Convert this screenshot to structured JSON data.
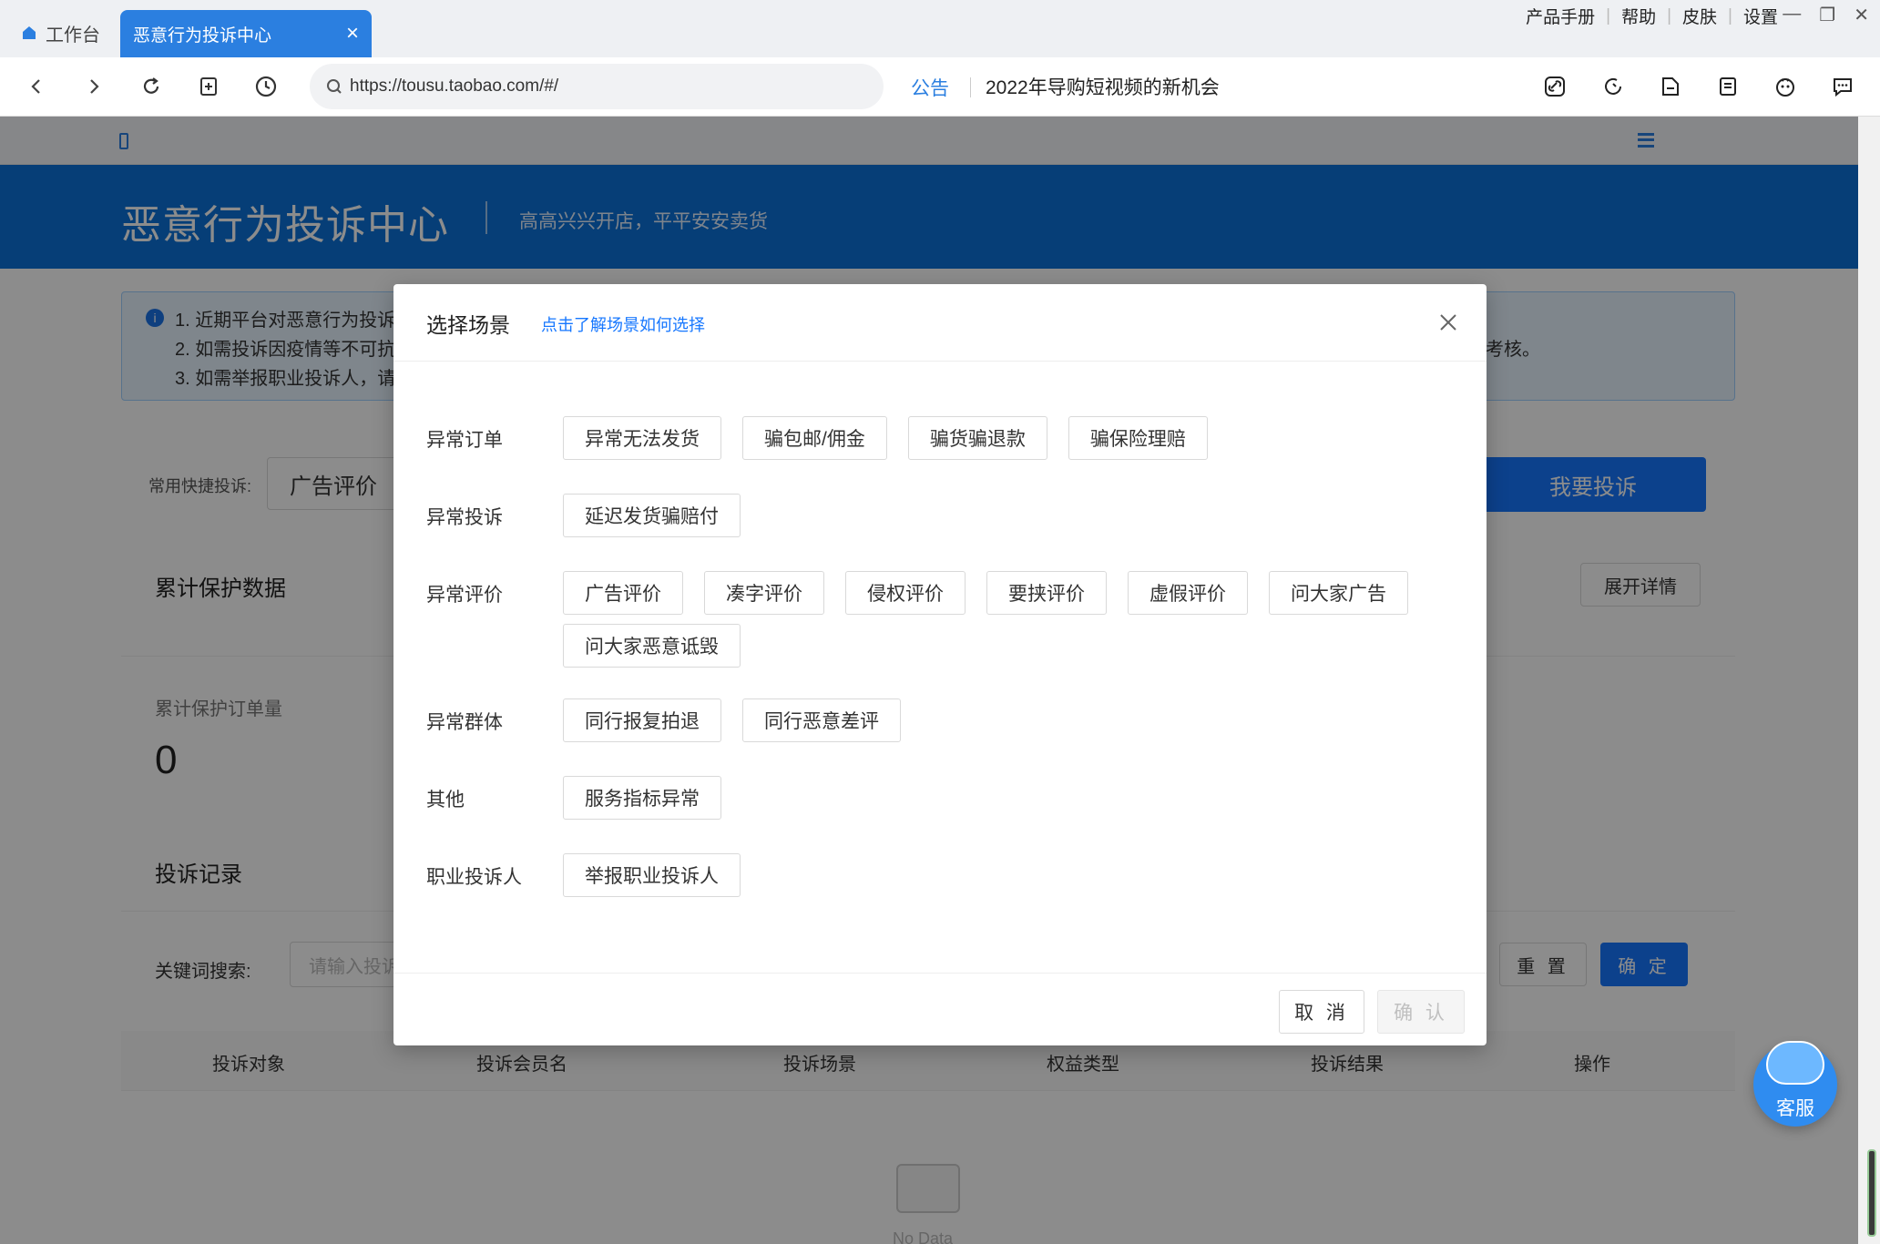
{
  "browser": {
    "tabs": [
      {
        "label": "工作台",
        "icon": "home-icon"
      },
      {
        "label": "恶意行为投诉中心",
        "close": "×"
      }
    ],
    "window_links": [
      "产品手册",
      "帮助",
      "皮肤",
      "设置"
    ],
    "url": "https://tousu.taobao.com/#/",
    "notice_label": "公告",
    "notice_text": "2022年导购短视频的新机会",
    "accent": "#2b7fe0"
  },
  "page": {
    "hero_title": "恶意行为投诉中心",
    "hero_subtitle": "高高兴兴开店，平平安安卖货",
    "alert_lines": [
      "1. 近期平台对恶意行为投诉",
      "2. 如需投诉因疫情等不可抗",
      "3. 如需举报职业投诉人，请"
    ],
    "alert_tail": "考核。",
    "quick_label": "常用快捷投诉:",
    "quick_value": "广告评价",
    "complain_button": "我要投诉",
    "protect_title": "累计保护数据",
    "expand_button": "展开详情",
    "stat_label": "累计保护订单量",
    "stat_value": "0",
    "records_title": "投诉记录",
    "keyword_label": "关键词搜索:",
    "keyword_placeholder": "请输入投诉",
    "reset_button": "重 置",
    "ok_button": "确 定",
    "table_headers": [
      "投诉对象",
      "投诉会员名",
      "投诉场景",
      "权益类型",
      "投诉结果",
      "操作"
    ],
    "empty_text": "No Data",
    "service_label": "客服",
    "brand_color": "#0b72d9"
  },
  "modal": {
    "title": "选择场景",
    "help_link": "点击了解场景如何选择",
    "groups": [
      {
        "label": "异常订单",
        "items": [
          "异常无法发货",
          "骗包邮/佣金",
          "骗货骗退款",
          "骗保险理赔"
        ]
      },
      {
        "label": "异常投诉",
        "items": [
          "延迟发货骗赔付"
        ]
      },
      {
        "label": "异常评价",
        "items": [
          "广告评价",
          "凑字评价",
          "侵权评价",
          "要挟评价",
          "虚假评价",
          "问大家广告",
          "问大家恶意诋毁"
        ]
      },
      {
        "label": "异常群体",
        "items": [
          "同行报复拍退",
          "同行恶意差评"
        ]
      },
      {
        "label": "其他",
        "items": [
          "服务指标异常"
        ]
      },
      {
        "label": "职业投诉人",
        "items": [
          "举报职业投诉人"
        ]
      }
    ],
    "cancel_button": "取 消",
    "confirm_button": "确 认"
  }
}
